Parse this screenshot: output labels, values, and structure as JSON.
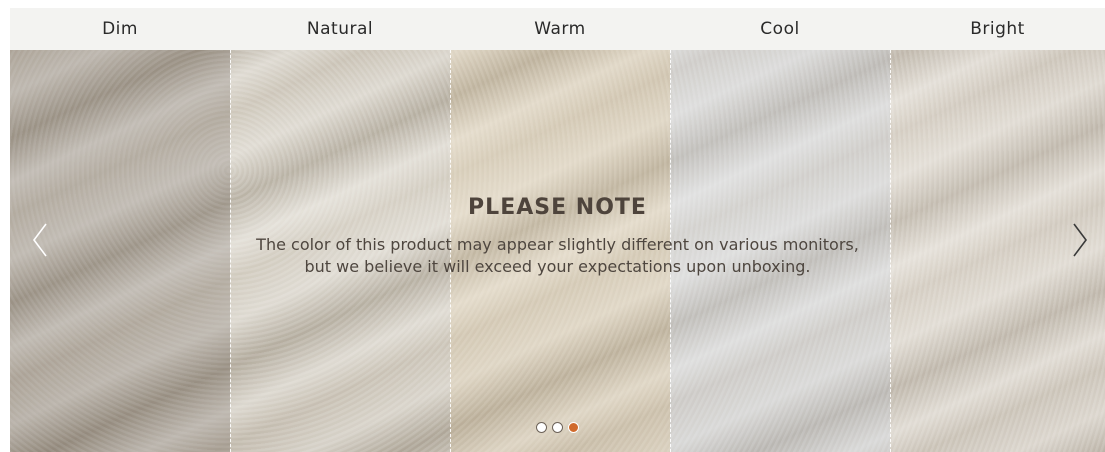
{
  "header": {
    "labels": [
      "Dim",
      "Natural",
      "Warm",
      "Cool",
      "Bright"
    ]
  },
  "note": {
    "title": "PLEASE NOTE",
    "line1": "The color of this product may appear slightly different on various monitors,",
    "line2": "but we believe it will exceed your expectations upon unboxing."
  },
  "navigation": {
    "prev_icon": "chevron-left-icon",
    "next_icon": "chevron-right-icon"
  },
  "pagination": {
    "count": 3,
    "active_index": 2,
    "active_color": "#d06a2c"
  },
  "colors": {
    "header_bg": "#f3f3f1",
    "note_text": "#4e443c"
  }
}
